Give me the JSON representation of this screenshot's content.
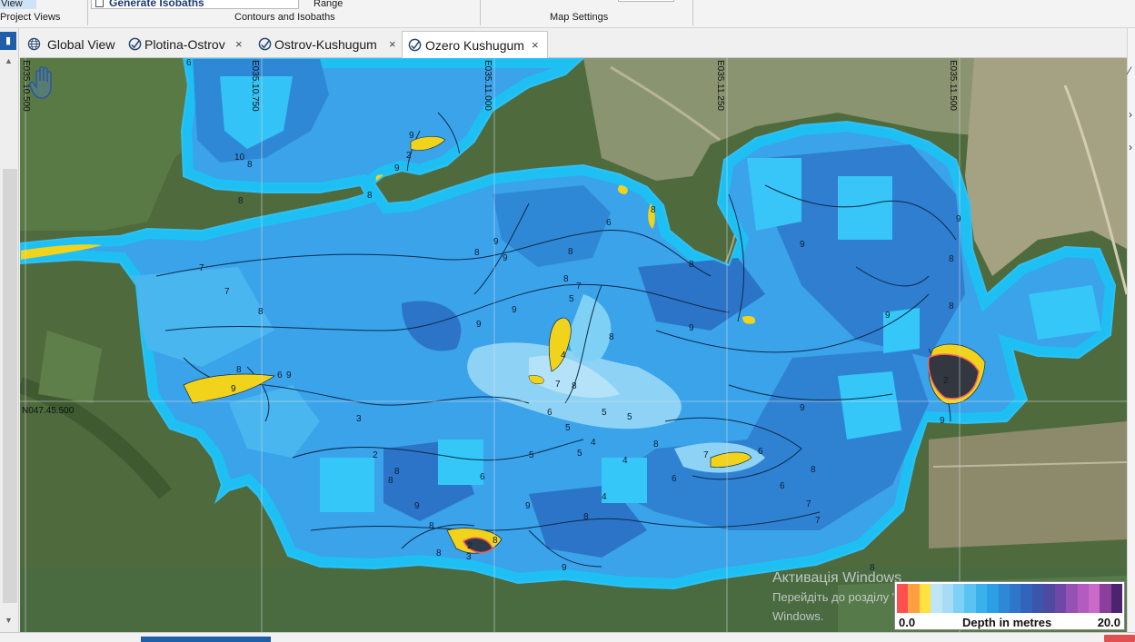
{
  "ribbon": {
    "view_label": "View",
    "project_views_label": "Project Views",
    "generate_isobaths_label": "Generate Isobaths",
    "range_label": "Range",
    "contours_group_label": "Contours and Isobaths",
    "map_settings_group_label": "Map Settings"
  },
  "tabs": [
    {
      "label": "Global View",
      "icon": "globe-icon",
      "closable": false,
      "active": false
    },
    {
      "label": "Plotina-Ostrov",
      "icon": "survey-icon",
      "closable": true,
      "active": false
    },
    {
      "label": "Ostrov-Kushugum",
      "icon": "survey-icon",
      "closable": true,
      "active": false
    },
    {
      "label": "Ozero Kushugum",
      "icon": "survey-icon",
      "closable": true,
      "active": true
    }
  ],
  "tab_close_glyph": "×",
  "map": {
    "grid_labels": {
      "lon_1": "E035.10.500",
      "lon_2": "E035.10.750",
      "lon_3": "E035.11.000",
      "lon_4": "E035.11.250",
      "lon_5": "E035.11.500",
      "lat_1": "N047.45.500"
    },
    "depth_marks": [
      "6",
      "10",
      "8",
      "8",
      "9",
      "2",
      "9",
      "8",
      "7",
      "7",
      "8",
      "8",
      "6",
      "9",
      "9",
      "8",
      "9",
      "9",
      "8",
      "8",
      "7",
      "6",
      "8",
      "8",
      "9",
      "5",
      "8",
      "9",
      "9",
      "4",
      "7",
      "8",
      "6",
      "5",
      "5",
      "4",
      "5",
      "8",
      "5",
      "4",
      "6",
      "6",
      "7",
      "7",
      "6",
      "7",
      "9",
      "9",
      "8",
      "2",
      "4",
      "8",
      "8",
      "8",
      "9",
      "9",
      "8",
      "2",
      "3",
      "8",
      "8",
      "3",
      "2",
      "9",
      "6",
      "5",
      "9",
      "8",
      "9",
      "9",
      "8",
      "8"
    ]
  },
  "legend": {
    "min_label": "0.0",
    "title": "Depth in metres",
    "max_label": "20.0",
    "colors": [
      "#ff4f4f",
      "#ff9f3f",
      "#ffe23d",
      "#bfe6f7",
      "#a6dcf5",
      "#7fd0f5",
      "#5bc3f2",
      "#3ab0ec",
      "#2b9fe3",
      "#2f88d6",
      "#2f75c9",
      "#3264bc",
      "#3a56ad",
      "#4d4aa0",
      "#6f48a7",
      "#9552b4",
      "#b35bc1",
      "#c96ac9",
      "#8a3f9a",
      "#4c2371"
    ]
  },
  "watermark": {
    "line1": "Активація Windows",
    "line2": "Перейдіть до розділу \"Настройки\", щоб активувати",
    "line3": "Windows."
  },
  "colors": {
    "accent": "#1f5fa8",
    "water_shallow": "#8ed3f6",
    "water_mid": "#34a2ea",
    "water_deep": "#2b74c8",
    "shoal_yellow": "#f2d31b",
    "land": "#4e6a3c"
  }
}
